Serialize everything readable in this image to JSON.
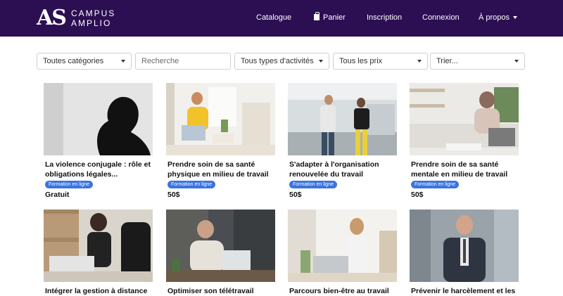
{
  "brand": {
    "mark": "AS",
    "line1": "CAMPUS",
    "line2": "AMPLIO"
  },
  "nav": {
    "catalogue": "Catalogue",
    "cart": "Panier",
    "register": "Inscription",
    "login": "Connexion",
    "about": "À propos"
  },
  "filters": {
    "category": "Toutes catégories",
    "search_placeholder": "Recherche",
    "activity": "Tous types d'activités",
    "price": "Tous les prix",
    "sort": "Trier..."
  },
  "colors": {
    "navbar": "#2c0e52",
    "badge": "#3b74e0"
  },
  "courses": [
    {
      "title": "La violence conjugale : rôle et obligations légales...",
      "badge": "Formation en ligne",
      "price": "Gratuit"
    },
    {
      "title": "Prendre soin de sa santé physique en milieu de travail",
      "badge": "Formation en ligne",
      "price": "50$"
    },
    {
      "title": "S'adapter à l'organisation renouvelée du travail",
      "badge": "Formation en ligne",
      "price": "50$"
    },
    {
      "title": "Prendre soin de sa santé mentale en milieu de travail",
      "badge": "Formation en ligne",
      "price": "50$"
    },
    {
      "title": "Intégrer la gestion à distance",
      "badge": "",
      "price": ""
    },
    {
      "title": "Optimiser son télétravail",
      "badge": "",
      "price": ""
    },
    {
      "title": "Parcours bien-être au travail",
      "badge": "",
      "price": ""
    },
    {
      "title": "Prévenir le harcèlement et les",
      "badge": "",
      "price": ""
    }
  ]
}
